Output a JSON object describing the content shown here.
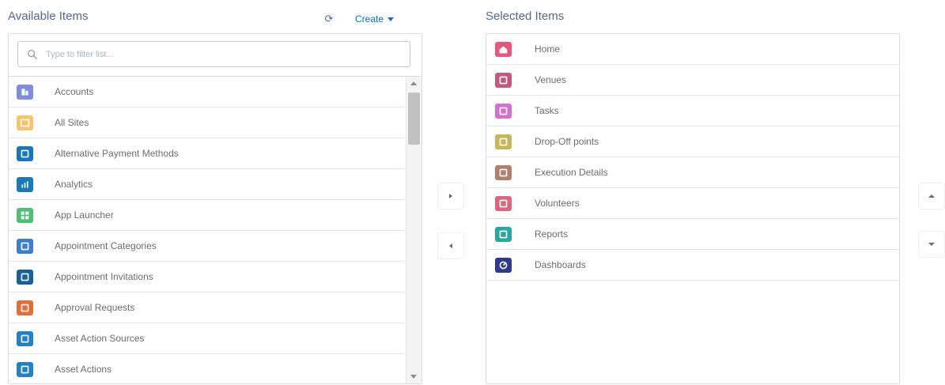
{
  "available": {
    "title": "Available Items",
    "refresh_label": "⟳",
    "create_label": "Create",
    "search_placeholder": "Type to filter list...",
    "items": [
      {
        "label": "Accounts",
        "color": "#7f8de1",
        "icon": "building-icon"
      },
      {
        "label": "All Sites",
        "color": "#f6c46a",
        "icon": "window-icon"
      },
      {
        "label": "Alternative Payment Methods",
        "color": "#1b75bb",
        "icon": "payment-icon"
      },
      {
        "label": "Analytics",
        "color": "#1a7ab5",
        "icon": "chart-icon"
      },
      {
        "label": "App Launcher",
        "color": "#4bc076",
        "icon": "grid-icon"
      },
      {
        "label": "Appointment Categories",
        "color": "#3c7ec9",
        "icon": "category-icon"
      },
      {
        "label": "Appointment Invitations",
        "color": "#17609c",
        "icon": "calendar-icon"
      },
      {
        "label": "Approval Requests",
        "color": "#e36e3a",
        "icon": "approval-icon"
      },
      {
        "label": "Asset Action Sources",
        "color": "#2580c3",
        "icon": "asset-source-icon"
      },
      {
        "label": "Asset Actions",
        "color": "#2580c3",
        "icon": "asset-action-icon"
      }
    ]
  },
  "selected": {
    "title": "Selected Items",
    "items": [
      {
        "label": "Home",
        "color": "#e5587d",
        "icon": "home-icon"
      },
      {
        "label": "Venues",
        "color": "#c2587a",
        "icon": "venue-icon"
      },
      {
        "label": "Tasks",
        "color": "#d46fd2",
        "icon": "task-icon"
      },
      {
        "label": "Drop-Off points",
        "color": "#c9b55a",
        "icon": "location-icon"
      },
      {
        "label": "Execution Details",
        "color": "#b0806a",
        "icon": "briefcase-icon"
      },
      {
        "label": "Volunteers",
        "color": "#d9677e",
        "icon": "people-icon"
      },
      {
        "label": "Reports",
        "color": "#2aa6a0",
        "icon": "report-icon"
      },
      {
        "label": "Dashboards",
        "color": "#2e3a8c",
        "icon": "dashboard-icon"
      }
    ]
  }
}
